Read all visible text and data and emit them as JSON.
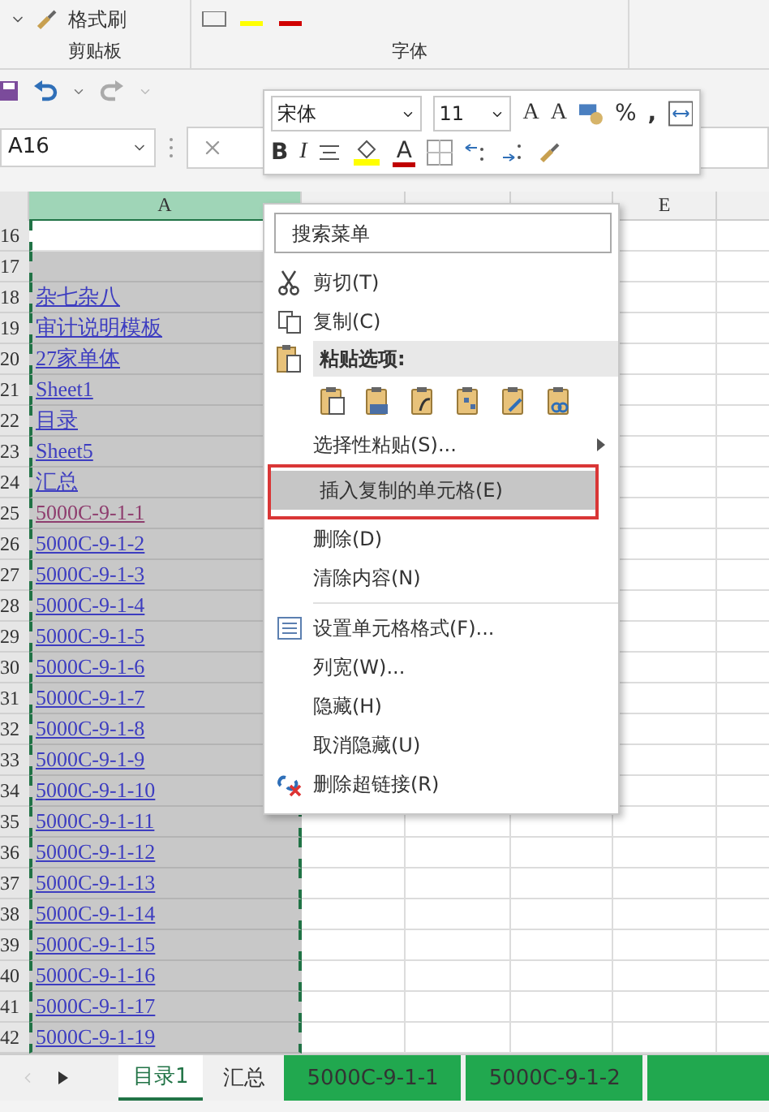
{
  "ribbon": {
    "groups": [
      {
        "label": "剪贴板",
        "button": "格式刷"
      },
      {
        "label": "字体"
      }
    ]
  },
  "name_box": {
    "value": "A16"
  },
  "mini_toolbar": {
    "font": "宋体",
    "size": "11",
    "grow": "A",
    "shrink": "A",
    "percent": "%",
    "comma": ",",
    "bold": "B",
    "italic": "I",
    "font_color": "A"
  },
  "columns": [
    {
      "label": "A",
      "selected": true
    },
    {
      "selected": false
    },
    {
      "selected": false
    },
    {
      "selected": false
    },
    {
      "label": "E",
      "selected": false
    }
  ],
  "rows": [
    {
      "number": "16",
      "active": true
    },
    {
      "number": "17",
      "active": false
    },
    {
      "number": "18",
      "value": "杂七杂八",
      "active": false,
      "visited": false
    },
    {
      "number": "19",
      "value": "审计说明模板",
      "active": false,
      "visited": false
    },
    {
      "number": "20",
      "value": "27家单体",
      "active": false,
      "visited": false
    },
    {
      "number": "21",
      "value": "Sheet1",
      "active": false,
      "visited": false
    },
    {
      "number": "22",
      "value": "目录",
      "active": false,
      "visited": false
    },
    {
      "number": "23",
      "value": "Sheet5",
      "active": false,
      "visited": false
    },
    {
      "number": "24",
      "value": "汇总",
      "active": false,
      "visited": false
    },
    {
      "number": "25",
      "value": "5000C-9-1-1",
      "active": false,
      "visited": true
    },
    {
      "number": "26",
      "value": "5000C-9-1-2",
      "active": false,
      "visited": false
    },
    {
      "number": "27",
      "value": "5000C-9-1-3",
      "active": false,
      "visited": false
    },
    {
      "number": "28",
      "value": "5000C-9-1-4",
      "active": false,
      "visited": false
    },
    {
      "number": "29",
      "value": "5000C-9-1-5",
      "active": false,
      "visited": false
    },
    {
      "number": "30",
      "value": "5000C-9-1-6",
      "active": false,
      "visited": false
    },
    {
      "number": "31",
      "value": "5000C-9-1-7",
      "active": false,
      "visited": false
    },
    {
      "number": "32",
      "value": "5000C-9-1-8",
      "active": false,
      "visited": false
    },
    {
      "number": "33",
      "value": "5000C-9-1-9",
      "active": false,
      "visited": false
    },
    {
      "number": "34",
      "value": "5000C-9-1-10",
      "active": false,
      "visited": false
    },
    {
      "number": "35",
      "value": "5000C-9-1-11",
      "active": false,
      "visited": false
    },
    {
      "number": "36",
      "value": "5000C-9-1-12",
      "active": false,
      "visited": false
    },
    {
      "number": "37",
      "value": "5000C-9-1-13",
      "active": false,
      "visited": false
    },
    {
      "number": "38",
      "value": "5000C-9-1-14",
      "active": false,
      "visited": false
    },
    {
      "number": "39",
      "value": "5000C-9-1-15",
      "active": false,
      "visited": false
    },
    {
      "number": "40",
      "value": "5000C-9-1-16",
      "active": false,
      "visited": false
    },
    {
      "number": "41",
      "value": "5000C-9-1-17",
      "active": false,
      "visited": false
    },
    {
      "number": "42",
      "value": "5000C-9-1-19",
      "active": false,
      "visited": false
    }
  ],
  "context_menu": {
    "search_placeholder": "搜索菜单",
    "items": [
      {
        "kind": "command",
        "label": "剪切(T)",
        "selected": false
      },
      {
        "kind": "command",
        "label": "复制(C)",
        "selected": false
      },
      {
        "kind": "header",
        "label": "粘贴选项:"
      },
      {
        "kind": "paste-options"
      },
      {
        "kind": "submenu",
        "label": "选择性粘贴(S)...",
        "selected": false
      },
      {
        "kind": "command",
        "label": "插入复制的单元格(E)",
        "selected": true
      },
      {
        "kind": "command",
        "label": "删除(D)",
        "selected": false
      },
      {
        "kind": "command",
        "label": "清除内容(N)",
        "selected": false
      },
      {
        "kind": "separator"
      },
      {
        "kind": "command",
        "label": "设置单元格格式(F)...",
        "selected": false
      },
      {
        "kind": "command",
        "label": "列宽(W)...",
        "selected": false
      },
      {
        "kind": "command",
        "label": "隐藏(H)",
        "selected": false
      },
      {
        "kind": "command",
        "label": "取消隐藏(U)",
        "selected": false
      },
      {
        "kind": "command",
        "label": "删除超链接(R)",
        "selected": false
      }
    ]
  },
  "sheet_tabs": [
    {
      "label": "目录1",
      "selected": true
    },
    {
      "label": "汇总",
      "selected": false
    },
    {
      "label": "5000C-9-1-1",
      "selected": false,
      "color": "#21a84f"
    },
    {
      "label": "5000C-9-1-2",
      "selected": false,
      "color": "#21a84f"
    },
    {
      "selected": false,
      "color": "#21a84f"
    }
  ]
}
